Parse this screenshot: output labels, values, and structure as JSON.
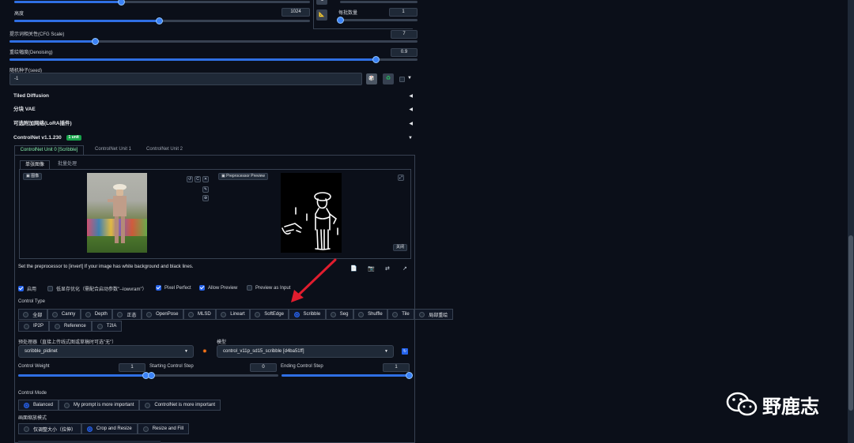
{
  "top_slider_a": {
    "value_fraction": 0.3
  },
  "height": {
    "label": "高度",
    "value": "1024"
  },
  "batch_size": {
    "label": "每批数量",
    "value": "1"
  },
  "swap_button": {
    "icon": "swap-icon",
    "label": "⇅"
  },
  "lock_button": {
    "icon": "ratio-lock-icon",
    "label": "📐"
  },
  "cfg": {
    "label": "提示词相关性(CFG Scale)",
    "value": "7"
  },
  "denoising": {
    "label": "重绘幅度(Denoising)",
    "value": "0.9"
  },
  "seed": {
    "label": "随机种子(seed)",
    "value": "-1",
    "dice_icon": "dice-icon",
    "recycle_icon": "recycle-icon",
    "dice_glyph": "🎲",
    "recycle_glyph": "♻",
    "extra_glyph": "▼"
  },
  "accordions": [
    {
      "label": "Tiled Diffusion",
      "caret": "◀"
    },
    {
      "label": "分块 VAE",
      "caret": "◀"
    },
    {
      "label": "可选附加网络(LoRA插件)",
      "caret": "◀"
    },
    {
      "label": "ControlNet v1.1.230",
      "caret": "▼",
      "badge": "1 unit"
    }
  ],
  "unit_tabs": [
    "ControlNet Unit 0 [Scribble]",
    "ControlNet Unit 1",
    "ControlNet Unit 2"
  ],
  "image_tabs": [
    "单张图像",
    "批量处理"
  ],
  "image_panel": {
    "label": "图像",
    "tools": [
      "↺",
      "C",
      "✕"
    ],
    "tools2": [
      "✎",
      "⊕"
    ]
  },
  "preview_panel": {
    "label": "Preprocessor Preview",
    "close_label": "关闭",
    "expand_glyph": "⤢"
  },
  "hint_text": "Set the preprocessor to [invert] If your image has white background and black lines.",
  "action_icons": [
    {
      "name": "new-canvas-icon",
      "glyph": "📄"
    },
    {
      "name": "camera-icon",
      "glyph": "📷"
    },
    {
      "name": "swap-icon",
      "glyph": "⇄"
    },
    {
      "name": "send-dimensions-icon",
      "glyph": "↗"
    }
  ],
  "checkboxes": [
    {
      "label": "启用",
      "checked": true
    },
    {
      "label": "低显存优化（需配合启动参数\"--lowvram\"）",
      "checked": false
    },
    {
      "label": "Pixel Perfect",
      "checked": true
    },
    {
      "label": "Allow Preview",
      "checked": true
    },
    {
      "label": "Preview as Input",
      "checked": false
    }
  ],
  "control_type": {
    "label": "Control Type",
    "row1": [
      "全部",
      "Canny",
      "Depth",
      "正态",
      "OpenPose",
      "MLSD",
      "Lineart",
      "SoftEdge",
      "Scribble",
      "Seg",
      "Shuffle",
      "Tile",
      "局部重绘"
    ],
    "row2": [
      "IP2P",
      "Reference",
      "T2IA"
    ],
    "selected": "Scribble"
  },
  "preprocessor": {
    "label": "预处理器（直接上传线式图或草稿时可选\"无\"）",
    "value": "scribble_pidinet",
    "run_glyph": "✹"
  },
  "model": {
    "label": "模型",
    "value": "control_v11p_sd15_scribble [d4ba51ff]",
    "refresh_glyph": "↻"
  },
  "control_weight": {
    "label": "Control Weight",
    "value": "1",
    "fraction": 1.0
  },
  "starting_step": {
    "label": "Starting Control Step",
    "value": "0",
    "fraction": 0.0
  },
  "ending_step": {
    "label": "Ending Control Step",
    "value": "1",
    "fraction": 1.0
  },
  "control_mode": {
    "label": "Control Mode",
    "options": [
      "Balanced",
      "My prompt is more important",
      "ControlNet is more important"
    ],
    "selected": "Balanced"
  },
  "resize_mode": {
    "label": "画面缩放模式",
    "options": [
      "仅调整大小（拉伸）",
      "Crop and Resize",
      "Resize and Fill"
    ],
    "selected": "Crop and Resize"
  },
  "watermark": {
    "text": "野鹿志"
  },
  "colors": {
    "accent": "#2563eb",
    "badge": "#16a34a",
    "arrow": "#e11d2e",
    "bg": "#0b0f19"
  }
}
